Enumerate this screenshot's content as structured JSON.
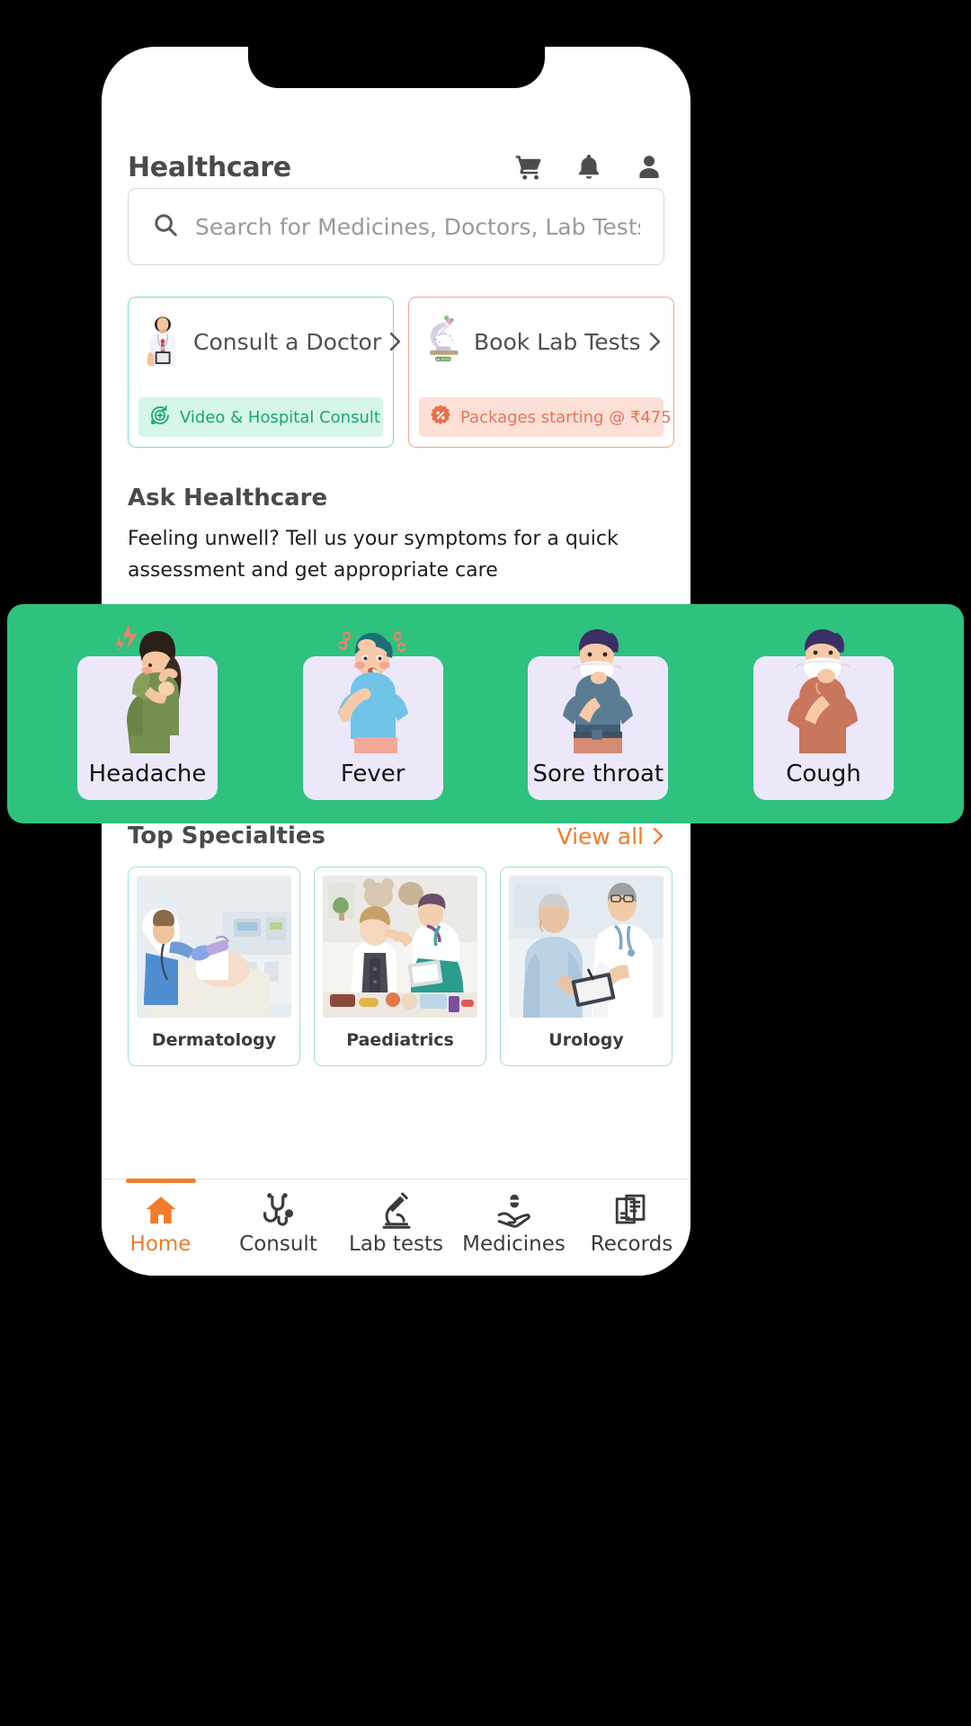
{
  "header": {
    "title": "Healthcare",
    "icons": [
      {
        "name": "cart-icon",
        "label": "Cart"
      },
      {
        "name": "bell-icon",
        "label": "Notifications"
      },
      {
        "name": "person-icon",
        "label": "Profile"
      }
    ]
  },
  "search": {
    "placeholder": "Search for Medicines, Doctors, Lab Tests",
    "value": "",
    "icon": "search-icon"
  },
  "quick_actions": [
    {
      "title": "Consult a Doctor",
      "badge": "Video & Hospital Consult",
      "badge_icon": "doctor-refresh-icon",
      "illustration": "doctor-illustration",
      "accent": "#7fdcc0",
      "badge_bg": "#d6f6e8",
      "badge_color": "#17a673"
    },
    {
      "title": "Book Lab Tests",
      "badge": "Packages starting @ ₹475",
      "badge_icon": "percent-badge-icon",
      "illustration": "microscope-illustration",
      "accent": "#efa590",
      "badge_bg": "#fcdfd6",
      "badge_color": "#e5765a"
    }
  ],
  "ask": {
    "title": "Ask Healthcare",
    "description": "Feeling unwell? Tell us your symptoms for a quick assessment and get appropriate care"
  },
  "symptoms": {
    "band_color": "#2ec27e",
    "chip_color": "#ece8fa",
    "items": [
      {
        "label": "Headache",
        "art": "woman-headache-illustration"
      },
      {
        "label": "Fever",
        "art": "boy-fever-illustration"
      },
      {
        "label": "Sore throat",
        "art": "man-sore-throat-illustration"
      },
      {
        "label": "Cough",
        "art": "man-cough-illustration"
      }
    ]
  },
  "specialties": {
    "title": "Top Specialties",
    "view_all": "View all",
    "view_all_color": "#f07c29",
    "items": [
      {
        "name": "Dermatology",
        "photo": "dermatology-photo"
      },
      {
        "name": "Paediatrics",
        "photo": "paediatrics-photo"
      },
      {
        "name": "Urology",
        "photo": "urology-photo"
      }
    ]
  },
  "bottom_nav": {
    "active_color": "#f07c29",
    "items": [
      {
        "label": "Home",
        "icon": "home-icon",
        "active": true
      },
      {
        "label": "Consult",
        "icon": "stethoscope-icon",
        "active": false
      },
      {
        "label": "Lab tests",
        "icon": "microscope-icon",
        "active": false
      },
      {
        "label": "Medicines",
        "icon": "pill-hand-icon",
        "active": false
      },
      {
        "label": "Records",
        "icon": "records-icon",
        "active": false
      }
    ]
  }
}
